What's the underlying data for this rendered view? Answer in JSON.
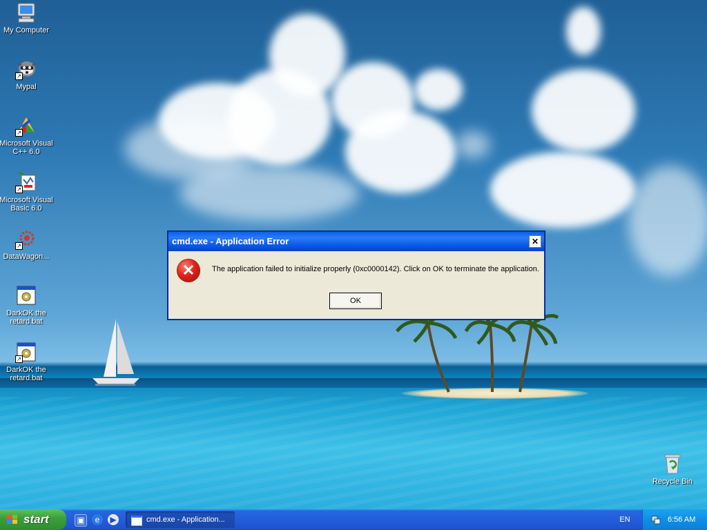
{
  "desktop": {
    "icons": [
      {
        "label": "My Computer",
        "icon": "my-computer-icon",
        "shortcut": false
      },
      {
        "label": "Mypal",
        "icon": "raccoon-icon",
        "shortcut": true
      },
      {
        "label": "Microsoft Visual C++ 6.0",
        "icon": "visual-cpp-icon",
        "shortcut": true
      },
      {
        "label": "Microsoft Visual Basic 6.0",
        "icon": "visual-basic-icon",
        "shortcut": true
      },
      {
        "label": "DataWagon...",
        "icon": "datawagon-icon",
        "shortcut": true
      },
      {
        "label": "DarkOK the retard.bat",
        "icon": "batch-file-icon",
        "shortcut": false
      },
      {
        "label": "DarkOK the retard.bat",
        "icon": "batch-file-icon",
        "shortcut": true
      },
      {
        "label": "Recycle Bin",
        "icon": "recycle-bin-icon",
        "shortcut": false
      }
    ]
  },
  "dialog": {
    "title": "cmd.exe - Application Error",
    "close_glyph": "✕",
    "icon": "error-icon",
    "message": "The application failed to initialize properly (0xc0000142). Click on OK to terminate the application.",
    "ok_label": "OK"
  },
  "taskbar": {
    "start_label": "start",
    "quick_launch": [
      "show-desktop-icon",
      "internet-explorer-icon",
      "media-player-icon"
    ],
    "task_label": "cmd.exe - Application...",
    "language": "EN",
    "clock": "6:56 AM"
  },
  "colors": {
    "title_bar": "#0a5ef0",
    "dialog_bg": "#ece9d8",
    "taskbar": "#245ddb",
    "start_button": "#3ca03c",
    "tray": "#0f8ee6",
    "error_red": "#e0241a"
  }
}
